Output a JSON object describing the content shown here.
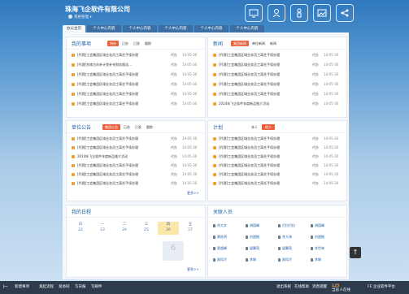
{
  "header": {
    "company": "珠海飞企软件有限公司",
    "user_label": "系统管理"
  },
  "top_icons": [
    "monitor-icon",
    "user-icon",
    "person-icon",
    "picture-icon",
    "share-icon"
  ],
  "tabs": [
    "办公主页",
    "个人中心内容",
    "个人中心内容",
    "个人中心内容",
    "个人中心内容",
    "个人中心内容"
  ],
  "panels": {
    "tasks": {
      "title": "我的事项",
      "tabs": [
        "待办",
        "已办",
        "已发",
        "跟踪"
      ],
      "rows": [
        {
          "text": "[代理]工会集团区域业务员工离任手续办理",
          "status": "代办",
          "date": "14-05-30"
        },
        {
          "text": "[代理]东南方向补计划补充财务报告…",
          "status": "代办",
          "date": "14-05-30"
        },
        {
          "text": "[代理]工会集团区域业务员工离任手续办理",
          "status": "代办",
          "date": "14-05-30"
        },
        {
          "text": "[代理]工会集团区域业务员工离任手续办理",
          "status": "代办",
          "date": "14-05-30"
        },
        {
          "text": "[代理]工会集团区域业务员工离任手续办理",
          "status": "代办",
          "date": "14-05-30"
        },
        {
          "text": "[代理]工会集团区域业务员工离任手续办理",
          "status": "代办",
          "date": "14-05-30"
        }
      ]
    },
    "news": {
      "title": "新闻",
      "tabs": [
        "集团新闻",
        "单位新闻",
        "新闻"
      ],
      "rows": [
        {
          "text": "[代理]工会集团区域业务员工离任手续办理",
          "status": "代办",
          "date": "14-05-30"
        },
        {
          "text": "[代理]工会集团区域业务员工离任手续办理",
          "status": "代办",
          "date": "14-05-30"
        },
        {
          "text": "[代理]工会集团区域业务员工离任手续办理",
          "status": "代办",
          "date": "14-05-30"
        },
        {
          "text": "[代理]工会集团区域业务员工离任手续办理",
          "status": "代办",
          "date": "14-05-30"
        },
        {
          "text": "[代理]工会集团区域业务员工离任手续办理",
          "status": "代办",
          "date": "14-05-30"
        },
        {
          "text": "2014年飞企软件年度新品推介活动",
          "status": "代办",
          "date": "14-05-30"
        }
      ]
    },
    "announcements": {
      "title": "单位公告",
      "tabs": [
        "集团公告",
        "已办",
        "已发",
        "跟踪"
      ],
      "rows": [
        {
          "text": "[代理]工会集团区域业务员工离任手续办理",
          "status": "代办",
          "date": "14-05-30"
        },
        {
          "text": "[代理]工会集团区域业务员工离任手续办理",
          "status": "代办",
          "date": "14-05-30"
        },
        {
          "text": "2014年飞企软件年度新品推介活动",
          "status": "代办",
          "date": "14-05-30"
        },
        {
          "text": "[代理]工会集团区域业务员工离任手续办理",
          "status": "代办",
          "date": "14-05-30"
        },
        {
          "text": "[代理]工会集团区域业务员工离任手续办理",
          "status": "代办",
          "date": "14-05-30"
        },
        {
          "text": "[代理]工会集团区域业务员工离任手续办理",
          "status": "代办",
          "date": "14-05-30"
        }
      ],
      "more": "更多>>"
    },
    "plan": {
      "title": "计划",
      "tabs": [
        "本人",
        "他人"
      ],
      "rows": [
        {
          "text": "[代理]工会集团区域业务员工离任手续办理",
          "status": "代办",
          "date": "14-05-30"
        },
        {
          "text": "[代理]工会集团区域业务员工离任手续办理",
          "status": "代办",
          "date": "14-05-30"
        },
        {
          "text": "[代理]工会集团区域业务员工离任手续办理",
          "status": "代办",
          "date": "14-05-30"
        },
        {
          "text": "[代理]工会集团区域业务员工离任手续办理",
          "status": "代办",
          "date": "14-05-30"
        },
        {
          "text": "[代理]工会集团区域业务员工离任手续办理",
          "status": "代办",
          "date": "14-05-30"
        },
        {
          "text": "[代理]工会集团区域业务员工离任手续办理",
          "status": "代办",
          "date": "14-05-30"
        }
      ]
    },
    "schedule": {
      "title": "我的日程",
      "days": [
        {
          "w": "日",
          "d": "22"
        },
        {
          "w": "一",
          "d": "23"
        },
        {
          "w": "二",
          "d": "24"
        },
        {
          "w": "三",
          "d": "25"
        },
        {
          "w": "四",
          "d": "26"
        },
        {
          "w": "五",
          "d": "27"
        }
      ],
      "today_day": "6",
      "more": "更多>>"
    },
    "contacts": {
      "title": "关联人员",
      "people": [
        "徐大文",
        "胡国峰",
        "巴拉巴拉",
        "胡国峰",
        "黄秋明",
        "刘超楷",
        "李大海",
        "刘超楷",
        "夏超峰",
        "梁翼亮",
        "梁翼亮",
        "苏世林",
        "周凤才",
        "李琳",
        "周凤才",
        "李琳"
      ]
    }
  },
  "footer": {
    "items": [
      "新建事项",
      "发起流程",
      "发协同",
      "写日报",
      "写邮件"
    ],
    "right": [
      "退出系统",
      "在线帮助",
      "消息提醒"
    ],
    "online_prefix": "当前",
    "online_count": "125",
    "online_suffix": "人在线",
    "brand": "FE 企业软件平台"
  },
  "colors": {
    "accent": "#e9623d",
    "header_blue": "#2f78bd",
    "link": "#1f5fa8",
    "footer": "#2d3b4d"
  }
}
